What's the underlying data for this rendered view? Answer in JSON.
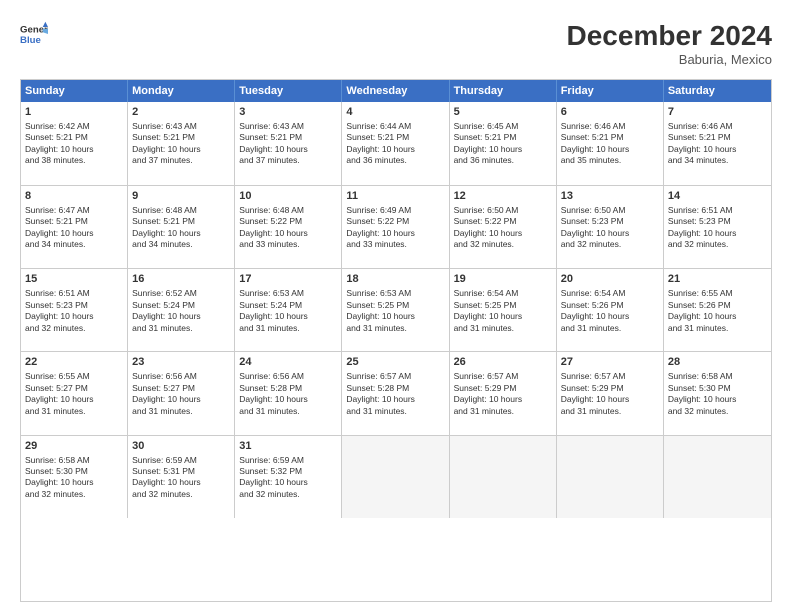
{
  "logo": {
    "line1": "General",
    "line2": "Blue"
  },
  "header": {
    "month": "December 2024",
    "location": "Baburia, Mexico"
  },
  "weekdays": [
    "Sunday",
    "Monday",
    "Tuesday",
    "Wednesday",
    "Thursday",
    "Friday",
    "Saturday"
  ],
  "rows": [
    [
      {
        "day": "1",
        "info": "Sunrise: 6:42 AM\nSunset: 5:21 PM\nDaylight: 10 hours\nand 38 minutes."
      },
      {
        "day": "2",
        "info": "Sunrise: 6:43 AM\nSunset: 5:21 PM\nDaylight: 10 hours\nand 37 minutes."
      },
      {
        "day": "3",
        "info": "Sunrise: 6:43 AM\nSunset: 5:21 PM\nDaylight: 10 hours\nand 37 minutes."
      },
      {
        "day": "4",
        "info": "Sunrise: 6:44 AM\nSunset: 5:21 PM\nDaylight: 10 hours\nand 36 minutes."
      },
      {
        "day": "5",
        "info": "Sunrise: 6:45 AM\nSunset: 5:21 PM\nDaylight: 10 hours\nand 36 minutes."
      },
      {
        "day": "6",
        "info": "Sunrise: 6:46 AM\nSunset: 5:21 PM\nDaylight: 10 hours\nand 35 minutes."
      },
      {
        "day": "7",
        "info": "Sunrise: 6:46 AM\nSunset: 5:21 PM\nDaylight: 10 hours\nand 34 minutes."
      }
    ],
    [
      {
        "day": "8",
        "info": "Sunrise: 6:47 AM\nSunset: 5:21 PM\nDaylight: 10 hours\nand 34 minutes."
      },
      {
        "day": "9",
        "info": "Sunrise: 6:48 AM\nSunset: 5:21 PM\nDaylight: 10 hours\nand 34 minutes."
      },
      {
        "day": "10",
        "info": "Sunrise: 6:48 AM\nSunset: 5:22 PM\nDaylight: 10 hours\nand 33 minutes."
      },
      {
        "day": "11",
        "info": "Sunrise: 6:49 AM\nSunset: 5:22 PM\nDaylight: 10 hours\nand 33 minutes."
      },
      {
        "day": "12",
        "info": "Sunrise: 6:50 AM\nSunset: 5:22 PM\nDaylight: 10 hours\nand 32 minutes."
      },
      {
        "day": "13",
        "info": "Sunrise: 6:50 AM\nSunset: 5:23 PM\nDaylight: 10 hours\nand 32 minutes."
      },
      {
        "day": "14",
        "info": "Sunrise: 6:51 AM\nSunset: 5:23 PM\nDaylight: 10 hours\nand 32 minutes."
      }
    ],
    [
      {
        "day": "15",
        "info": "Sunrise: 6:51 AM\nSunset: 5:23 PM\nDaylight: 10 hours\nand 32 minutes."
      },
      {
        "day": "16",
        "info": "Sunrise: 6:52 AM\nSunset: 5:24 PM\nDaylight: 10 hours\nand 31 minutes."
      },
      {
        "day": "17",
        "info": "Sunrise: 6:53 AM\nSunset: 5:24 PM\nDaylight: 10 hours\nand 31 minutes."
      },
      {
        "day": "18",
        "info": "Sunrise: 6:53 AM\nSunset: 5:25 PM\nDaylight: 10 hours\nand 31 minutes."
      },
      {
        "day": "19",
        "info": "Sunrise: 6:54 AM\nSunset: 5:25 PM\nDaylight: 10 hours\nand 31 minutes."
      },
      {
        "day": "20",
        "info": "Sunrise: 6:54 AM\nSunset: 5:26 PM\nDaylight: 10 hours\nand 31 minutes."
      },
      {
        "day": "21",
        "info": "Sunrise: 6:55 AM\nSunset: 5:26 PM\nDaylight: 10 hours\nand 31 minutes."
      }
    ],
    [
      {
        "day": "22",
        "info": "Sunrise: 6:55 AM\nSunset: 5:27 PM\nDaylight: 10 hours\nand 31 minutes."
      },
      {
        "day": "23",
        "info": "Sunrise: 6:56 AM\nSunset: 5:27 PM\nDaylight: 10 hours\nand 31 minutes."
      },
      {
        "day": "24",
        "info": "Sunrise: 6:56 AM\nSunset: 5:28 PM\nDaylight: 10 hours\nand 31 minutes."
      },
      {
        "day": "25",
        "info": "Sunrise: 6:57 AM\nSunset: 5:28 PM\nDaylight: 10 hours\nand 31 minutes."
      },
      {
        "day": "26",
        "info": "Sunrise: 6:57 AM\nSunset: 5:29 PM\nDaylight: 10 hours\nand 31 minutes."
      },
      {
        "day": "27",
        "info": "Sunrise: 6:57 AM\nSunset: 5:29 PM\nDaylight: 10 hours\nand 31 minutes."
      },
      {
        "day": "28",
        "info": "Sunrise: 6:58 AM\nSunset: 5:30 PM\nDaylight: 10 hours\nand 32 minutes."
      }
    ],
    [
      {
        "day": "29",
        "info": "Sunrise: 6:58 AM\nSunset: 5:30 PM\nDaylight: 10 hours\nand 32 minutes."
      },
      {
        "day": "30",
        "info": "Sunrise: 6:59 AM\nSunset: 5:31 PM\nDaylight: 10 hours\nand 32 minutes."
      },
      {
        "day": "31",
        "info": "Sunrise: 6:59 AM\nSunset: 5:32 PM\nDaylight: 10 hours\nand 32 minutes."
      },
      {
        "day": "",
        "info": ""
      },
      {
        "day": "",
        "info": ""
      },
      {
        "day": "",
        "info": ""
      },
      {
        "day": "",
        "info": ""
      }
    ]
  ]
}
